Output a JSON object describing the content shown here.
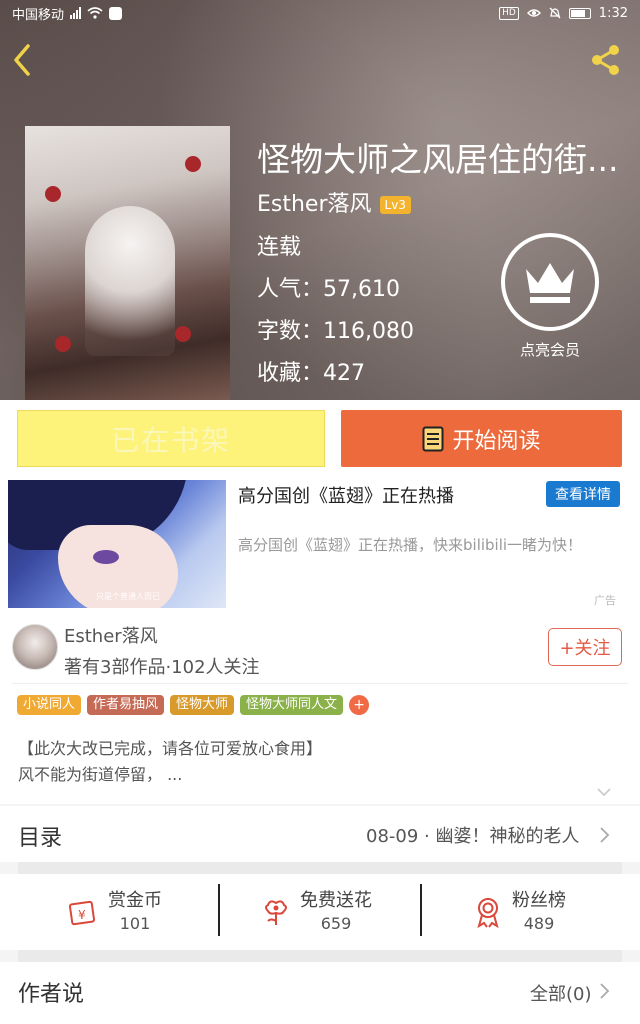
{
  "status_bar": {
    "carrier": "中国移动",
    "time": "1:32"
  },
  "book": {
    "title": "怪物大师之风居住的街...",
    "author": "Esther落风",
    "level": "Lv3",
    "status": "连载",
    "popularity_label": "人气：57,610",
    "wordcount_label": "字数：116,080",
    "favorites_label": "收藏：427"
  },
  "vip": {
    "label": "点亮会员"
  },
  "actions": {
    "shelf_label": "已在书架",
    "read_label": "开始阅读"
  },
  "ad": {
    "title": "高分国创《蓝翅》正在热播",
    "more_label": "查看详情",
    "description": "高分国创《蓝翅》正在热播，快来bilibili一睹为快！",
    "tag": "广告",
    "image_caption": "只是个普通人而已"
  },
  "author_card": {
    "name": "Esther落风",
    "subtitle": "著有3部作品·102人关注",
    "follow_label": "+关注"
  },
  "tags": [
    {
      "label": "小说同人",
      "color": "#f0a933"
    },
    {
      "label": "作者易抽风",
      "color": "#c46a55"
    },
    {
      "label": "怪物大师",
      "color": "#d99a2c"
    },
    {
      "label": "怪物大师同人文",
      "color": "#8bb24a"
    }
  ],
  "description": {
    "line1": "【此次大改已完成，请各位可爱放心食用】",
    "line2": "风不能为街道停留， ..."
  },
  "catalog": {
    "label": "目录",
    "latest": "08-09 · 幽婆！神秘的老人"
  },
  "gifts": [
    {
      "label": "赏金币",
      "value": "101",
      "icon": "coin-ticket-icon"
    },
    {
      "label": "免费送花",
      "value": "659",
      "icon": "flower-icon"
    },
    {
      "label": "粉丝榜",
      "value": "489",
      "icon": "medal-icon"
    }
  ],
  "author_talk": {
    "label": "作者说",
    "all_label": "全部(0)"
  },
  "colors": {
    "read_button": "#ec6a3c",
    "shelf_button": "#fdf27a",
    "accent": "#e35a45",
    "ad_button": "#1a7ad0"
  }
}
